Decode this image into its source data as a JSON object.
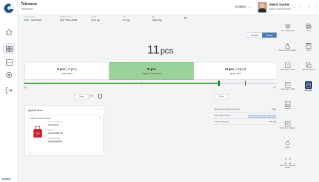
{
  "header": {
    "title": "Tolerance",
    "subtitle": "Tolerance",
    "language": "English",
    "user_name": "Albert Sautter",
    "user_role": "Admin, Administrator"
  },
  "info": {
    "status": "TOP",
    "columns": [
      {
        "label": "Serial number",
        "value": "KDF2023"
      },
      {
        "label": "Product name",
        "value": "EOP 3B-4-2050"
      },
      {
        "label": "Gross",
        "value": "10.5 kg"
      },
      {
        "label": "Tare",
        "value": "0.0 kg"
      },
      {
        "label": "Net",
        "value": "1000 mg"
      },
      {
        "label": "",
        "value": "50"
      }
    ]
  },
  "toggle": {
    "weight": "Weight",
    "count": "Count"
  },
  "result": {
    "value": "11",
    "unit": "pcs"
  },
  "tolerance": {
    "lower": {
      "value": "8 pcs",
      "delta": "(−2 pcs)",
      "label": "Lower limit"
    },
    "target": {
      "value": "10 pcs",
      "label": "Target in tolerance"
    },
    "upper": {
      "value": "12 pcs",
      "delta": "(+2 pcs)",
      "label": "Upper limit"
    },
    "progress": 0.77
  },
  "tare": {
    "button": "Tare",
    "value": "0.0"
  },
  "set_button": "Zero",
  "applied": {
    "title": "Applied items",
    "item_head": "Applied material (object)",
    "name_label": "Article material name",
    "name": "Foil 5 pcs",
    "id_label": "Article ID",
    "id": "HAS9088D7B",
    "ref_label": "Reference name",
    "ref": "HAS8394052"
  },
  "info_table": [
    {
      "key": "Reference weight per piece",
      "value": "10 g"
    },
    {
      "key": "Warnings source",
      "value": "Click here to create new entry",
      "link": true
    },
    {
      "key": "Total weight (g)",
      "value": "110.0 g"
    }
  ],
  "right_actions": [
    {
      "label": "List / switch tab",
      "icon": "list-icon"
    },
    {
      "label": "Print",
      "icon": "print-icon"
    },
    {
      "label": "Set reference weight",
      "icon": "weight-icon"
    },
    {
      "label": "Save",
      "icon": "save-icon"
    },
    {
      "label": "Auto-save / timer",
      "icon": "timer-icon"
    },
    {
      "label": "Save and print",
      "icon": "save-print-icon"
    },
    {
      "label": "Auto-save + Full",
      "icon": "auto-full-icon"
    },
    {
      "label": "Results",
      "icon": "results-icon"
    },
    {
      "label": "Statistic",
      "icon": "statistic-icon"
    },
    {
      "label": "Customer register",
      "icon": "customer-icon"
    },
    {
      "label": "Reset",
      "icon": "reset-icon"
    },
    {
      "label": "Switch to / from full screen",
      "icon": "fullscreen-icon"
    }
  ],
  "brand": "KERN"
}
